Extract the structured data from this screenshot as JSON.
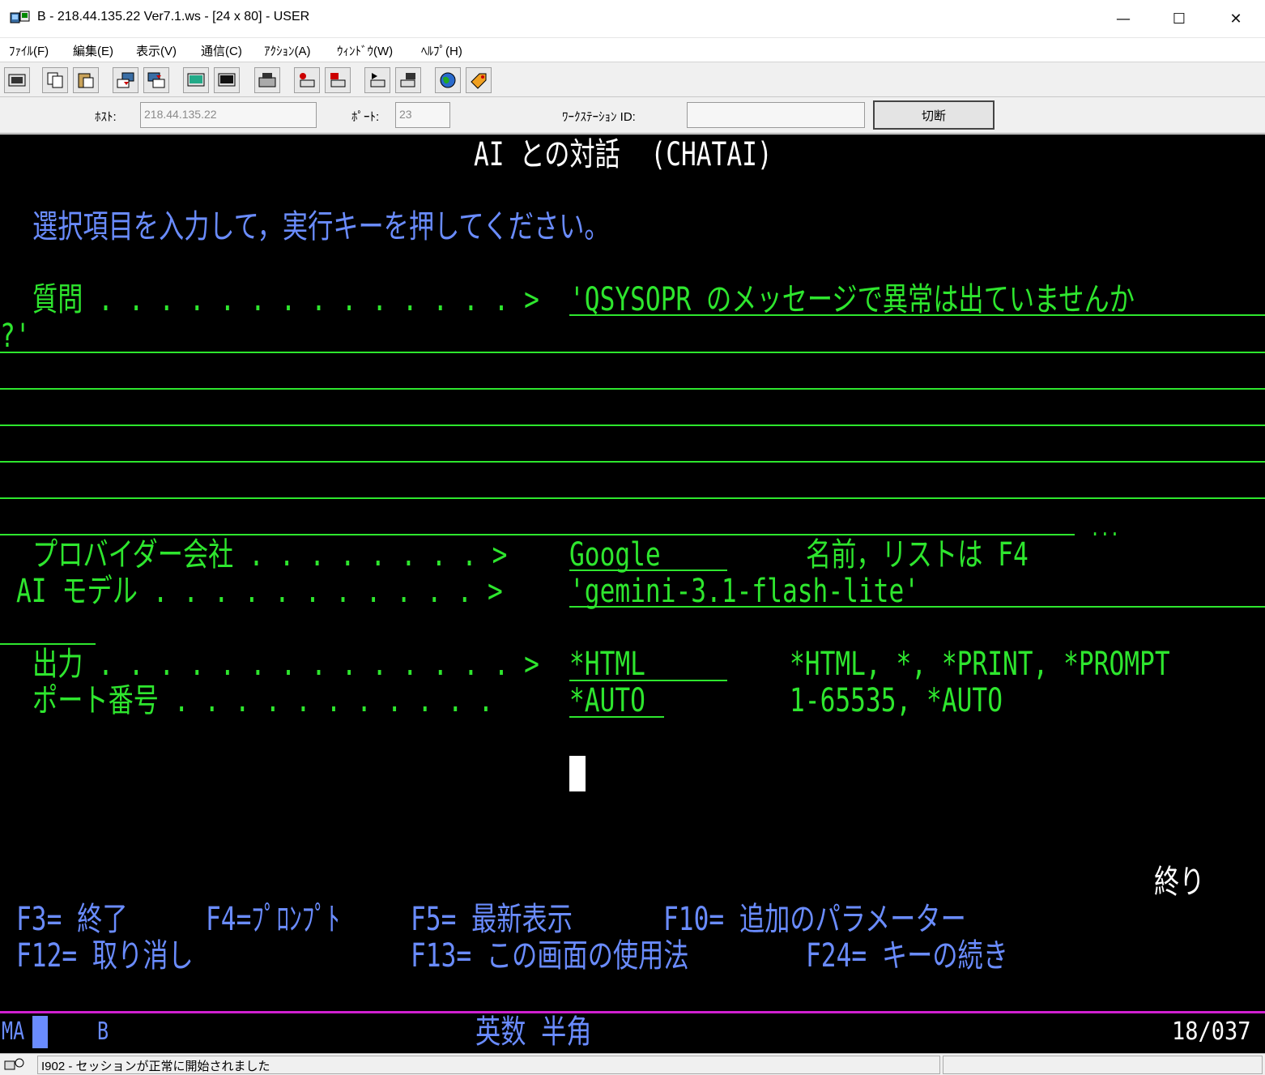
{
  "window": {
    "title": "B - 218.44.135.22 Ver7.1.ws - [24 x 80] - USER",
    "minimize": "—",
    "maximize": "☐",
    "close": "✕"
  },
  "menu": [
    "ﾌｧｲﾙ(F)",
    "編集(E)",
    "表示(V)",
    "通信(C)",
    "ｱｸｼｮﾝ(A)",
    "ｳｨﾝﾄﾞｳ(W)",
    "ﾍﾙﾌﾟ(H)"
  ],
  "toolbar_icons": [
    "print-screen-icon",
    "copy-icon",
    "paste-icon",
    "send-icon",
    "receive-icon",
    "display-icon",
    "display-alt-icon",
    "keyboard-icon",
    "macro-record-icon",
    "macro-stop-icon",
    "macro-play-icon",
    "macro-edit-icon",
    "globe-icon",
    "tag-icon"
  ],
  "connection": {
    "host_label": "ﾎｽﾄ:",
    "host_value": "218.44.135.22",
    "port_label": "ﾎﾟｰﾄ:",
    "port_value": "23",
    "workstation_label": "ﾜｰｸｽﾃｰｼｮﾝ ID:",
    "workstation_value": "",
    "disconnect_label": "切断"
  },
  "terminal": {
    "title": "AI との対話  (CHATAI)",
    "instruction": "選択項目を入力して，実行キーを押してください。",
    "question_label": "質問 . . . . . . . . . . . . . . >",
    "question_value_1": "'QSYSOPR のメッセージで異常は出ていませんか",
    "question_value_2": "?'",
    "ellipsis": "...",
    "provider_label": "プロバイダー会社 . . . . . . . . >",
    "provider_value": "Google",
    "provider_hint": "名前，リストは F4",
    "model_label": "AI モデル . . . . . . . . . . . >",
    "model_value": "'gemini-3.1-flash-lite'",
    "output_label": "出力 . . . . . . . . . . . . . . >",
    "output_value": "*HTML",
    "output_hint": "*HTML, *, *PRINT, *PROMPT",
    "port_label": "ポート番号 . . . . . . . . . . .",
    "port_value": "*AUTO",
    "port_hint": "1-65535, *AUTO",
    "end_label": "終り",
    "fkeys_row1": [
      {
        "key": "F3= 終了"
      },
      {
        "key": "F4=ﾌﾟﾛﾝﾌﾟﾄ"
      },
      {
        "key": "F5= 最新表示"
      },
      {
        "key": "F10= 追加のパラメーター"
      }
    ],
    "fkeys_row2": [
      {
        "key": "F12= 取り消し"
      },
      {
        "key": "F13= この画面の使用法"
      },
      {
        "key": "F24= キーの続き"
      }
    ],
    "status_ma": "MA",
    "status_session": "B",
    "status_mode": "英数 半角",
    "status_pos": "18/037"
  },
  "statusbar": {
    "message": "I902 - セッションが正常に開始されました"
  },
  "colors": {
    "terminal_bg": "#000000",
    "terminal_green": "#2ee62e",
    "terminal_blue": "#6a8cff",
    "terminal_white": "#ffffff",
    "status_divider": "#d020d0"
  }
}
